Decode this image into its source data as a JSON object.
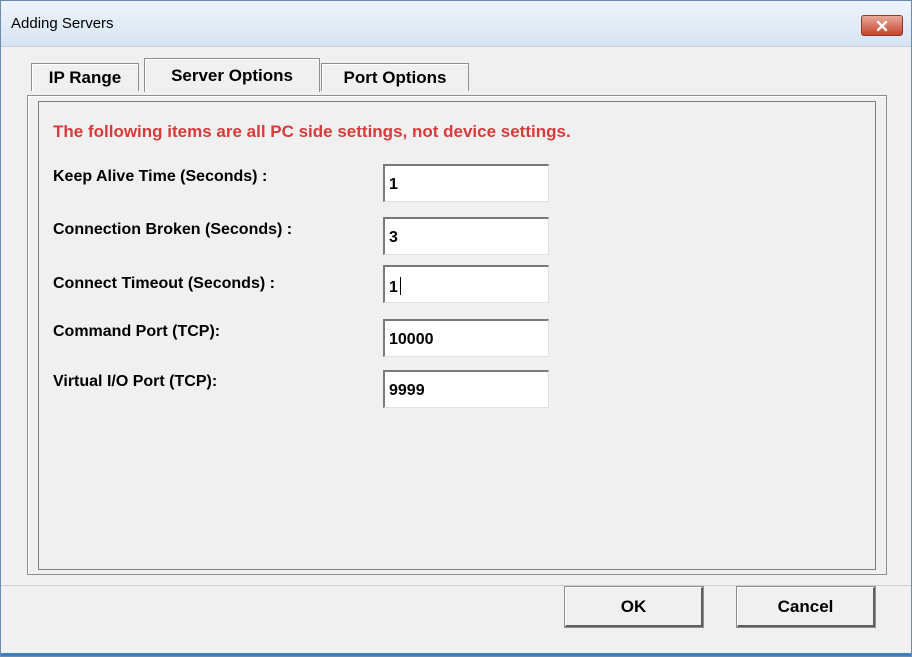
{
  "window": {
    "title": "Adding Servers"
  },
  "tabs": [
    {
      "label": "IP Range",
      "active": false
    },
    {
      "label": "Server Options",
      "active": true
    },
    {
      "label": "Port Options",
      "active": false
    }
  ],
  "panel": {
    "notice": "The following items are all PC side settings, not device settings.",
    "notice_color": "#d93a3a",
    "fields": [
      {
        "label": "Keep Alive Time (Seconds) :",
        "value": "1"
      },
      {
        "label": "Connection Broken (Seconds) :",
        "value": "3"
      },
      {
        "label": "Connect Timeout (Seconds) :",
        "value": "1"
      },
      {
        "label": "Command Port (TCP):",
        "value": "10000"
      },
      {
        "label": "Virtual I/O Port (TCP):",
        "value": "9999"
      }
    ]
  },
  "buttons": {
    "ok": "OK",
    "cancel": "Cancel"
  },
  "icons": {
    "close": "close-icon"
  }
}
